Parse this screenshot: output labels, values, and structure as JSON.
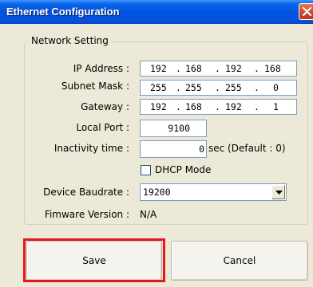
{
  "window": {
    "title": "Ethernet Configuration"
  },
  "group": {
    "label": "Network Setting"
  },
  "ip_address": {
    "label": "IP Address :",
    "octets": [
      "192",
      "168",
      "192",
      "168"
    ]
  },
  "subnet_mask": {
    "label": "Subnet Mask :",
    "octets": [
      "255",
      "255",
      "255",
      "0"
    ]
  },
  "gateway": {
    "label": "Gateway :",
    "octets": [
      "192",
      "168",
      "192",
      "1"
    ]
  },
  "local_port": {
    "label": "Local Port :",
    "value": "9100"
  },
  "inactivity": {
    "label": "Inactivity time :",
    "value": "0",
    "suffix": "sec (Default : 0)"
  },
  "dhcp": {
    "label": "DHCP Mode",
    "checked": false
  },
  "baudrate": {
    "label": "Device Baudrate :",
    "value": "19200"
  },
  "firmware": {
    "label": "Fimware Version :",
    "value": "N/A"
  },
  "buttons": {
    "save": "Save",
    "cancel": "Cancel"
  },
  "colors": {
    "title_bar": "#0053e1",
    "dialog_bg": "#ece9d8",
    "highlight": "#e8161b"
  },
  "icons": {
    "close": "close-icon",
    "dropdown": "chevron-down-icon"
  }
}
